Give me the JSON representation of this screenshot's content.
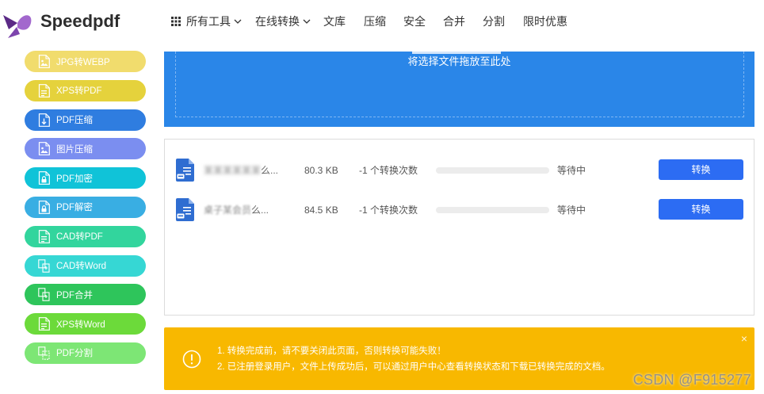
{
  "brand": {
    "name": "Speedpdf",
    "logo_icon": "butterfly-logo-icon"
  },
  "theme": {
    "primary": "#2a86e8",
    "button": "#2c6cf3",
    "notice": "#f8b800",
    "logo_dark": "#5b2a86",
    "logo_mid": "#7d45ad",
    "logo_light": "#a268cd"
  },
  "nav": [
    {
      "label": "所有工具",
      "icon": "grid-icon",
      "dropdown": true
    },
    {
      "label": "在线转换",
      "dropdown": true
    },
    {
      "label": "文库"
    },
    {
      "label": "压缩"
    },
    {
      "label": "安全"
    },
    {
      "label": "合并"
    },
    {
      "label": "分割"
    },
    {
      "label": "限时优惠"
    }
  ],
  "sidebar": {
    "items": [
      {
        "label": "JPG转WEBP",
        "color": "#f1dc6d",
        "icon": "image-file-icon"
      },
      {
        "label": "XPS转PDF",
        "color": "#e5d23c",
        "icon": "xps-file-icon"
      },
      {
        "label": "PDF压缩",
        "color": "#2f7de0",
        "icon": "pdf-compress-icon"
      },
      {
        "label": "图片压缩",
        "color": "#7b8ef0",
        "icon": "image-compress-icon"
      },
      {
        "label": "PDF加密",
        "color": "#10c3d8",
        "icon": "pdf-lock-icon"
      },
      {
        "label": "PDF解密",
        "color": "#39aee3",
        "icon": "pdf-unlock-icon"
      },
      {
        "label": "CAD转PDF",
        "color": "#32d59d",
        "icon": "cad-file-icon"
      },
      {
        "label": "CAD转Word",
        "color": "#36d7d4",
        "icon": "cad-word-icon"
      },
      {
        "label": "PDF合并",
        "color": "#2ec55b",
        "icon": "pdf-merge-icon"
      },
      {
        "label": "XPS转Word",
        "color": "#6cda3a",
        "icon": "xps-word-icon"
      },
      {
        "label": "PDF分割",
        "color": "#7de675",
        "icon": "pdf-split-icon"
      }
    ]
  },
  "dropzone": {
    "text": "将选择文件拖放至此处"
  },
  "files": [
    {
      "icon": "pdf-file-icon",
      "name_blurred": "某某某某某某",
      "name_tail": "么...",
      "size": "80.3 KB",
      "conversions": "-1 个转换次数",
      "progress": 0,
      "status": "等待中",
      "action": "转换"
    },
    {
      "icon": "pdf-file-icon",
      "name_blurred": "桌子某会员",
      "name_tail": "么...",
      "size": "84.5 KB",
      "conversions": "-1 个转换次数",
      "progress": 0,
      "status": "等待中",
      "action": "转换"
    }
  ],
  "notice": {
    "icon": "exclamation-circle-icon",
    "lines": [
      "1. 转换完成前，请不要关闭此页面，否则转换可能失败！",
      "2. 已注册登录用户，文件上传成功后，可以通过用户中心查看转换状态和下载已转换完成的文档。"
    ],
    "close": "×"
  },
  "watermark": "CSDN @F915277"
}
